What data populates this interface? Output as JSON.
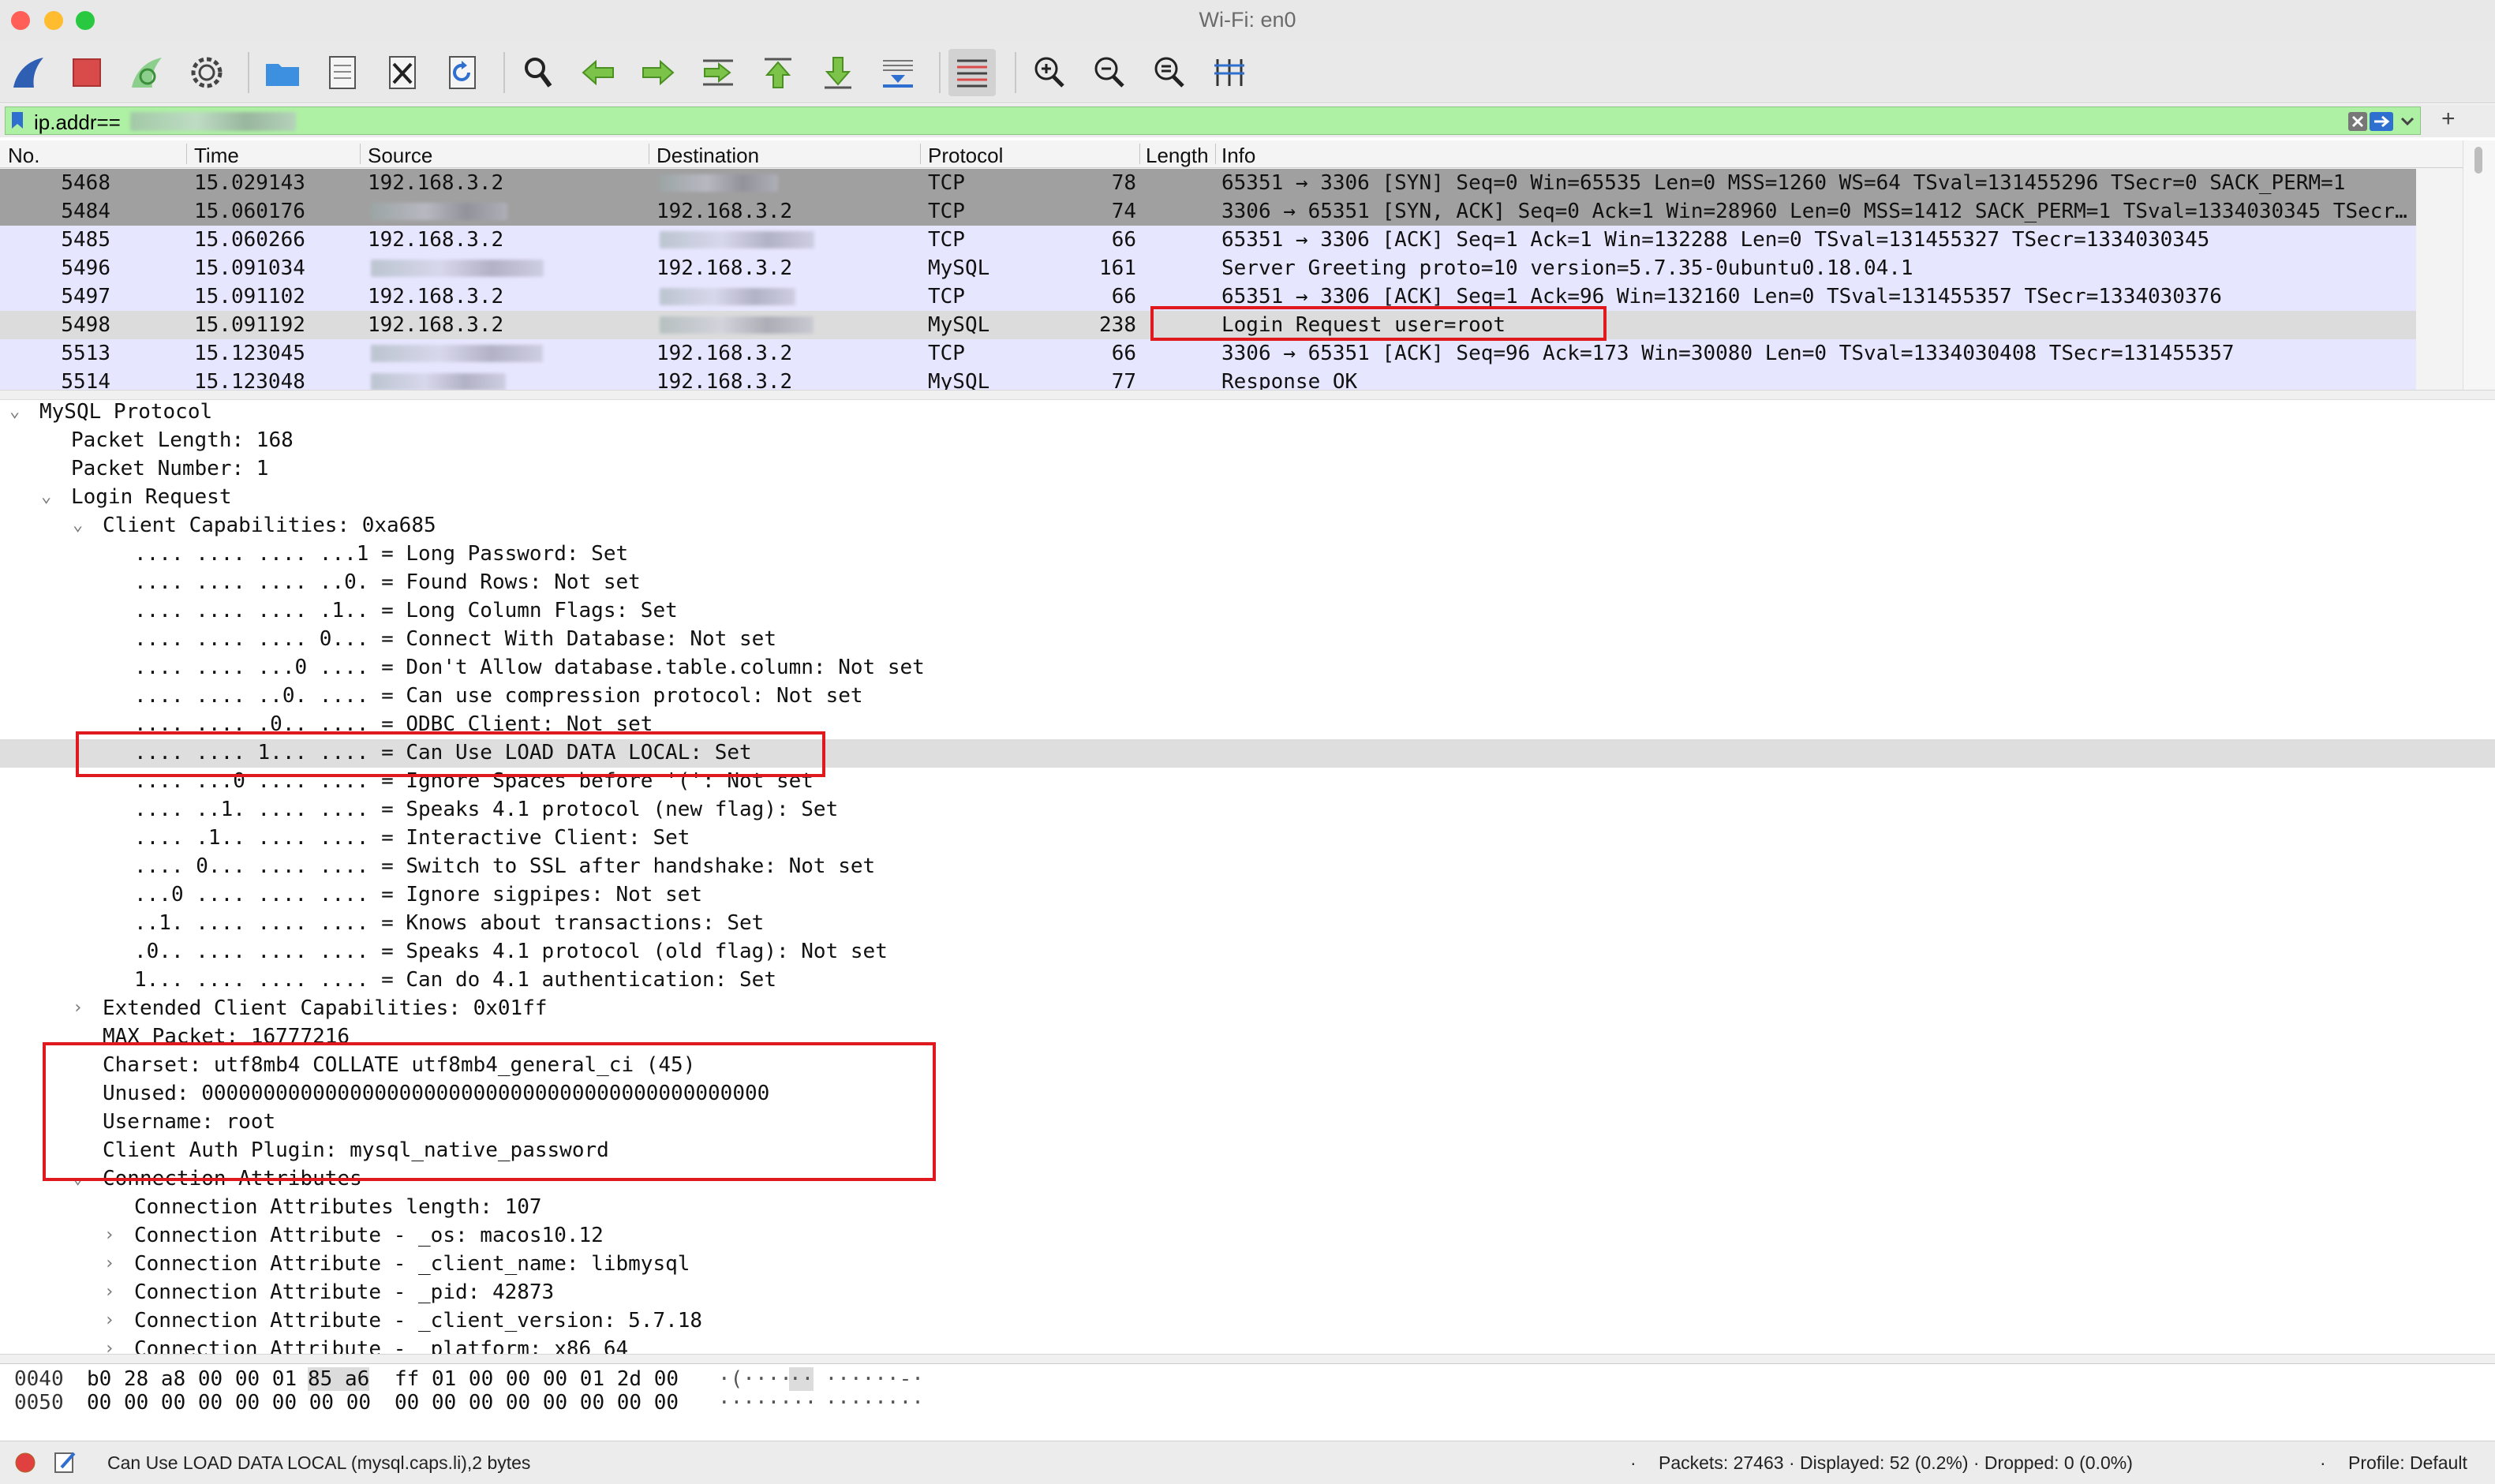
{
  "window": {
    "title": "Wi-Fi: en0"
  },
  "colors": {
    "close": "#ff5f57",
    "minimize": "#febc2e",
    "maximize": "#28c840",
    "filter_bg": "#aef0a4",
    "row_tcp": "#e7e6ff",
    "row_gray": "#a0a0a0",
    "row_selected": "#dcdcdc",
    "highlight": "#e0191e"
  },
  "toolbar": {
    "icons": [
      "shark-fin-icon",
      "stop-icon",
      "restart-fin-icon",
      "gear-icon",
      "folder-icon",
      "file-icon",
      "close-file-icon",
      "reload-icon",
      "search-icon",
      "back-arrow-icon",
      "forward-arrow-icon",
      "jump-icon",
      "first-packet-icon",
      "last-packet-icon",
      "autoscroll-icon",
      "colorize-icon",
      "zoom-in-icon",
      "zoom-out-icon",
      "zoom-normal-icon",
      "resize-columns-icon"
    ]
  },
  "filter": {
    "value": "ip.addr=="
  },
  "packet_list": {
    "columns": [
      "No.",
      "Time",
      "Source",
      "Destination",
      "Protocol",
      "Length",
      "Info"
    ],
    "rows": [
      {
        "no": "5468",
        "time": "15.029143",
        "source": "192.168.3.2",
        "destination": "",
        "protocol": "TCP",
        "length": "78",
        "info": "65351 → 3306 [SYN] Seq=0 Win=65535 Len=0 MSS=1260 WS=64 TSval=131455296 TSecr=0 SACK_PERM=1",
        "style": "gray"
      },
      {
        "no": "5484",
        "time": "15.060176",
        "source": "",
        "destination": "192.168.3.2",
        "protocol": "TCP",
        "length": "74",
        "info": "3306 → 65351 [SYN, ACK] Seq=0 Ack=1 Win=28960 Len=0 MSS=1412 SACK_PERM=1 TSval=1334030345 TSecr…",
        "style": "gray"
      },
      {
        "no": "5485",
        "time": "15.060266",
        "source": "192.168.3.2",
        "destination": "",
        "protocol": "TCP",
        "length": "66",
        "info": "65351 → 3306 [ACK] Seq=1 Ack=1 Win=132288 Len=0 TSval=131455327 TSecr=1334030345",
        "style": "tcp"
      },
      {
        "no": "5496",
        "time": "15.091034",
        "source": "",
        "destination": "192.168.3.2",
        "protocol": "MySQL",
        "length": "161",
        "info": "Server Greeting proto=10 version=5.7.35-0ubuntu0.18.04.1",
        "style": "tcp"
      },
      {
        "no": "5497",
        "time": "15.091102",
        "source": "192.168.3.2",
        "destination": "",
        "protocol": "TCP",
        "length": "66",
        "info": "65351 → 3306 [ACK] Seq=1 Ack=96 Win=132160 Len=0 TSval=131455357 TSecr=1334030376",
        "style": "tcp"
      },
      {
        "no": "5498",
        "time": "15.091192",
        "source": "192.168.3.2",
        "destination": "",
        "protocol": "MySQL",
        "length": "238",
        "info": "Login Request user=root",
        "style": "selected"
      },
      {
        "no": "5513",
        "time": "15.123045",
        "source": "",
        "destination": "192.168.3.2",
        "protocol": "TCP",
        "length": "66",
        "info": "3306 → 65351 [ACK] Seq=96 Ack=173 Win=30080 Len=0 TSval=1334030408 TSecr=131455357",
        "style": "tcp"
      },
      {
        "no": "5514",
        "time": "15.123048",
        "source": "",
        "destination": "192.168.3.2",
        "protocol": "MySQL",
        "length": "77",
        "info": "Response OK",
        "style": "tcp"
      }
    ]
  },
  "detail": {
    "lines": [
      {
        "text": "MySQL Protocol",
        "indent": 0,
        "toggle": "open"
      },
      {
        "text": "Packet Length: 168",
        "indent": 1,
        "toggle": ""
      },
      {
        "text": "Packet Number: 1",
        "indent": 1,
        "toggle": ""
      },
      {
        "text": "Login Request",
        "indent": 1,
        "toggle": "open"
      },
      {
        "text": "Client Capabilities: 0xa685",
        "indent": 2,
        "toggle": "open"
      },
      {
        "text": ".... .... .... ...1 = Long Password: Set",
        "indent": 3,
        "toggle": ""
      },
      {
        "text": ".... .... .... ..0. = Found Rows: Not set",
        "indent": 3,
        "toggle": ""
      },
      {
        "text": ".... .... .... .1.. = Long Column Flags: Set",
        "indent": 3,
        "toggle": ""
      },
      {
        "text": ".... .... .... 0... = Connect With Database: Not set",
        "indent": 3,
        "toggle": ""
      },
      {
        "text": ".... .... ...0 .... = Don't Allow database.table.column: Not set",
        "indent": 3,
        "toggle": ""
      },
      {
        "text": ".... .... ..0. .... = Can use compression protocol: Not set",
        "indent": 3,
        "toggle": ""
      },
      {
        "text": ".... .... .0.. .... = ODBC Client: Not set",
        "indent": 3,
        "toggle": ""
      },
      {
        "text": ".... .... 1... .... = Can Use LOAD DATA LOCAL: Set",
        "indent": 3,
        "toggle": "",
        "selected": true
      },
      {
        "text": ".... ...0 .... .... = Ignore Spaces before '(': Not set",
        "indent": 3,
        "toggle": ""
      },
      {
        "text": ".... ..1. .... .... = Speaks 4.1 protocol (new flag): Set",
        "indent": 3,
        "toggle": ""
      },
      {
        "text": ".... .1.. .... .... = Interactive Client: Set",
        "indent": 3,
        "toggle": ""
      },
      {
        "text": ".... 0... .... .... = Switch to SSL after handshake: Not set",
        "indent": 3,
        "toggle": ""
      },
      {
        "text": "...0 .... .... .... = Ignore sigpipes: Not set",
        "indent": 3,
        "toggle": ""
      },
      {
        "text": "..1. .... .... .... = Knows about transactions: Set",
        "indent": 3,
        "toggle": ""
      },
      {
        "text": ".0.. .... .... .... = Speaks 4.1 protocol (old flag): Not set",
        "indent": 3,
        "toggle": ""
      },
      {
        "text": "1... .... .... .... = Can do 4.1 authentication: Set",
        "indent": 3,
        "toggle": ""
      },
      {
        "text": "Extended Client Capabilities: 0x01ff",
        "indent": 2,
        "toggle": "closed"
      },
      {
        "text": "MAX Packet: 16777216",
        "indent": 2,
        "toggle": ""
      },
      {
        "text": "Charset: utf8mb4 COLLATE utf8mb4_general_ci (45)",
        "indent": 2,
        "toggle": ""
      },
      {
        "text": "Unused: 0000000000000000000000000000000000000000000000",
        "indent": 2,
        "toggle": ""
      },
      {
        "text": "Username: root",
        "indent": 2,
        "toggle": ""
      },
      {
        "text": "Client Auth Plugin: mysql_native_password",
        "indent": 2,
        "toggle": ""
      },
      {
        "text": "Connection Attributes",
        "indent": 2,
        "toggle": "open"
      },
      {
        "text": "Connection Attributes length: 107",
        "indent": 3,
        "toggle": ""
      },
      {
        "text": "Connection Attribute - _os: macos10.12",
        "indent": 3,
        "toggle": "closed"
      },
      {
        "text": "Connection Attribute - _client_name: libmysql",
        "indent": 3,
        "toggle": "closed"
      },
      {
        "text": "Connection Attribute - _pid: 42873",
        "indent": 3,
        "toggle": "closed"
      },
      {
        "text": "Connection Attribute - _client_version: 5.7.18",
        "indent": 3,
        "toggle": "closed"
      },
      {
        "text": "Connection Attribute - _platform: x86_64",
        "indent": 3,
        "toggle": "closed"
      }
    ]
  },
  "bytes": {
    "rows": [
      {
        "offset": "0040",
        "hex_a": "b0 28 a8 00 00 01",
        "hex_sel": "85 a6",
        "hex_b": "ff 01 00 00 00 01 2d 00",
        "ascii_a": "·(····",
        "ascii_sel": "··",
        "ascii_b": " ······-·"
      },
      {
        "offset": "0050",
        "hex_a": "00 00 00 00 00 00 00 00",
        "hex_sel": "",
        "hex_b": "00 00 00 00 00 00 00 00",
        "ascii_a": "········",
        "ascii_sel": "",
        "ascii_b": " ········"
      }
    ]
  },
  "status": {
    "field": "Can Use LOAD DATA LOCAL (mysql.caps.li),2 bytes",
    "packets": "Packets: 27463 · Displayed: 52 (0.2%) · Dropped: 0 (0.0%)",
    "profile": "Profile: Default"
  }
}
